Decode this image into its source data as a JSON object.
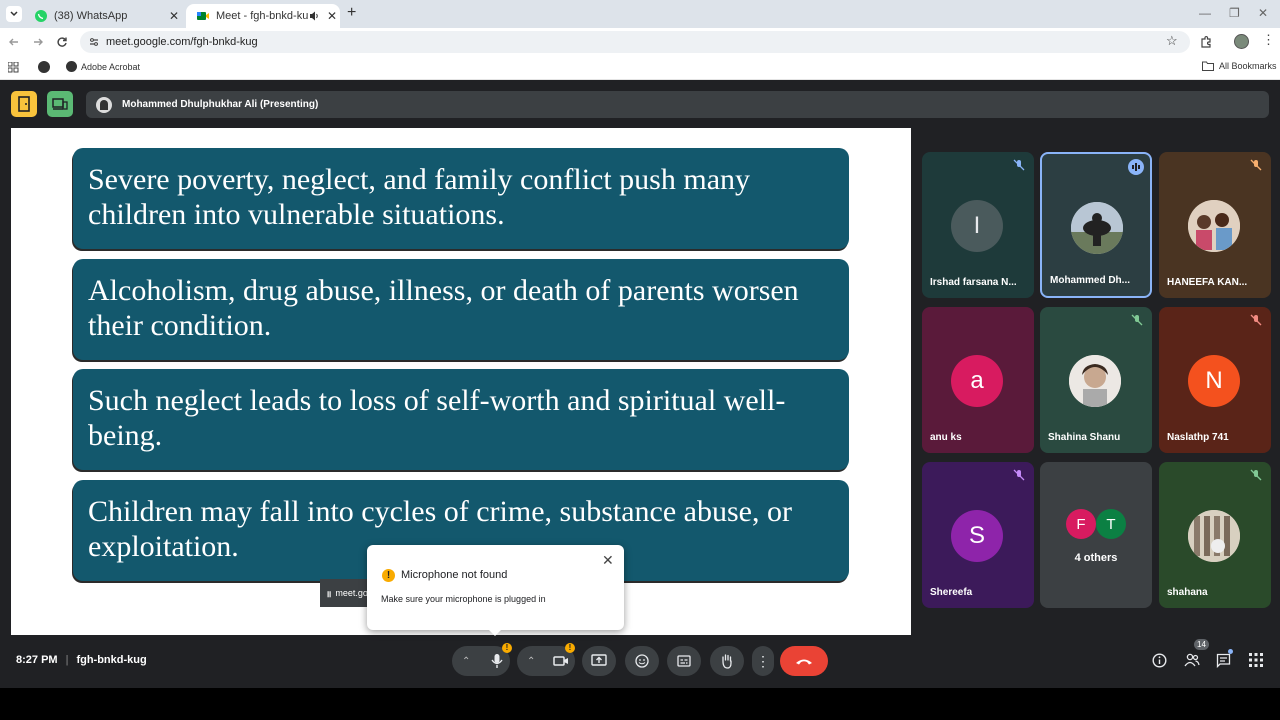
{
  "browser": {
    "tabs": [
      {
        "title": "(38) WhatsApp",
        "active": false
      },
      {
        "title": "Meet - fgh-bnkd-kug",
        "active": true
      }
    ],
    "url": "meet.google.com/fgh-bnkd-kug",
    "bookmark_item": "Adobe Acrobat",
    "all_bookmarks": "All Bookmarks"
  },
  "meet": {
    "presenter_label": "Mohammed Dhulphukhar Ali (Presenting)",
    "slide_bullets": [
      "Severe poverty, neglect, and family conflict push many children into vulnerable situations.",
      "Alcoholism, drug abuse, illness, or death of parents worsen their condition.",
      "Such neglect leads to loss of self-worth and spiritual well-being.",
      "Children may fall into cycles of crime, substance abuse, or exploitation."
    ],
    "participants": [
      {
        "name": "Irshad farsana N...",
        "initial": "I",
        "muted": true
      },
      {
        "name": "Mohammed Dh...",
        "initial": "",
        "speaking": true
      },
      {
        "name": "HANEEFA KAN...",
        "initial": "",
        "muted": true
      },
      {
        "name": "anu ks",
        "initial": "a",
        "muted": false
      },
      {
        "name": "Shahina Shanu",
        "initial": "",
        "muted": true
      },
      {
        "name": "Naslathp 741",
        "initial": "N",
        "muted": true
      },
      {
        "name": "Shereefa",
        "initial": "S",
        "muted": true
      },
      {
        "name": "4 others",
        "initials": [
          "F",
          "T"
        ]
      },
      {
        "name": "shahana",
        "initial": "",
        "muted": true
      }
    ],
    "toast": {
      "title": "Microphone not found",
      "body": "Make sure your microphone is plugged in"
    },
    "snip_label": "meet.goo",
    "time": "8:27 PM",
    "meeting_code": "fgh-bnkd-kug",
    "people_count": "14",
    "colors": {
      "slide_box": "#13586d",
      "end_call": "#ea4335",
      "background": "#202124"
    }
  }
}
